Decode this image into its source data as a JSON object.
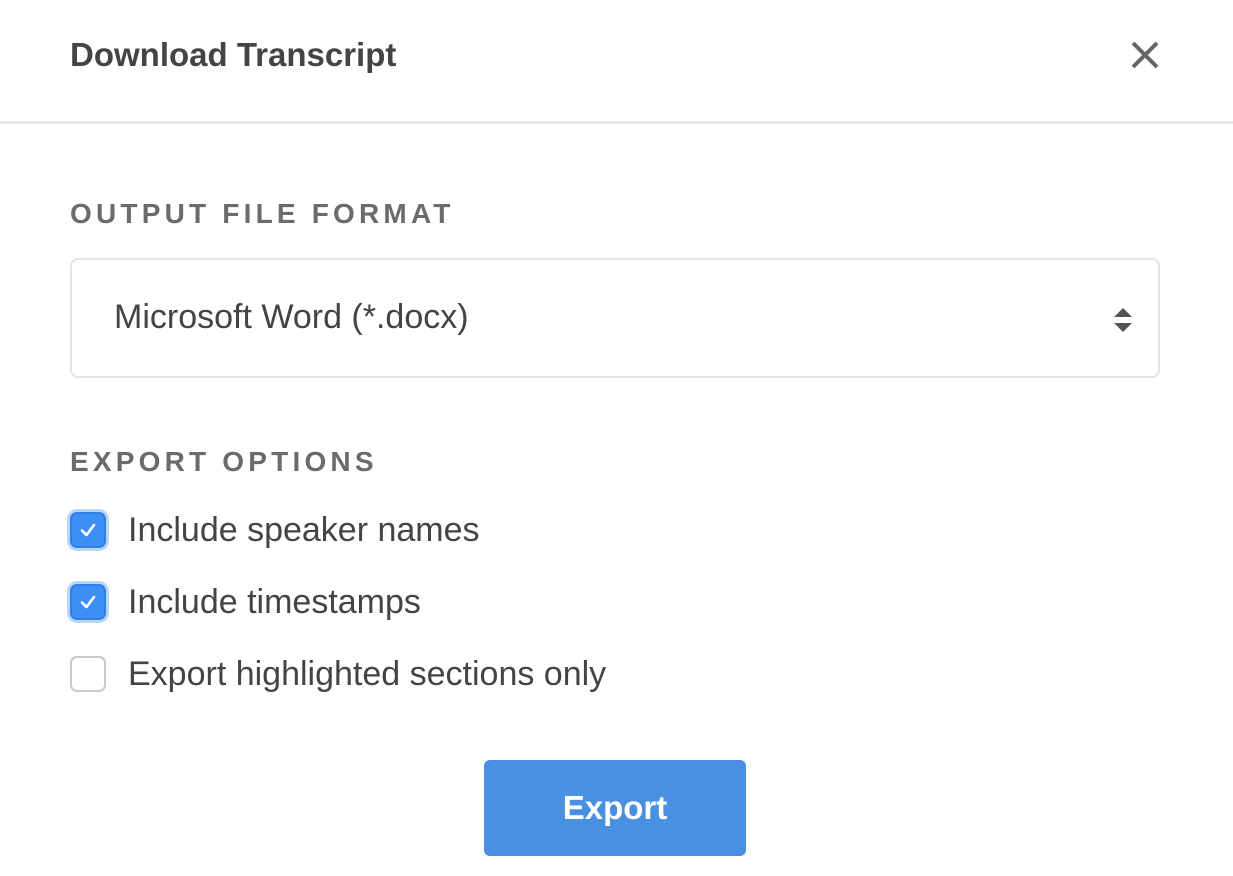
{
  "dialog": {
    "title": "Download Transcript",
    "close_icon": "close-icon"
  },
  "format": {
    "label": "OUTPUT FILE FORMAT",
    "selected": "Microsoft Word (*.docx)",
    "arrows_icon": "select-updown-icon"
  },
  "options": {
    "label": "EXPORT OPTIONS",
    "items": [
      {
        "label": "Include speaker names",
        "checked": true
      },
      {
        "label": "Include timestamps",
        "checked": true
      },
      {
        "label": "Export highlighted sections only",
        "checked": false
      }
    ]
  },
  "actions": {
    "export_label": "Export"
  },
  "colors": {
    "accent": "#4a90e2",
    "checkbox_checked": "#3d8ff5",
    "text": "#444444",
    "section_label": "#6b6b6b",
    "divider": "#e6e6e6"
  }
}
